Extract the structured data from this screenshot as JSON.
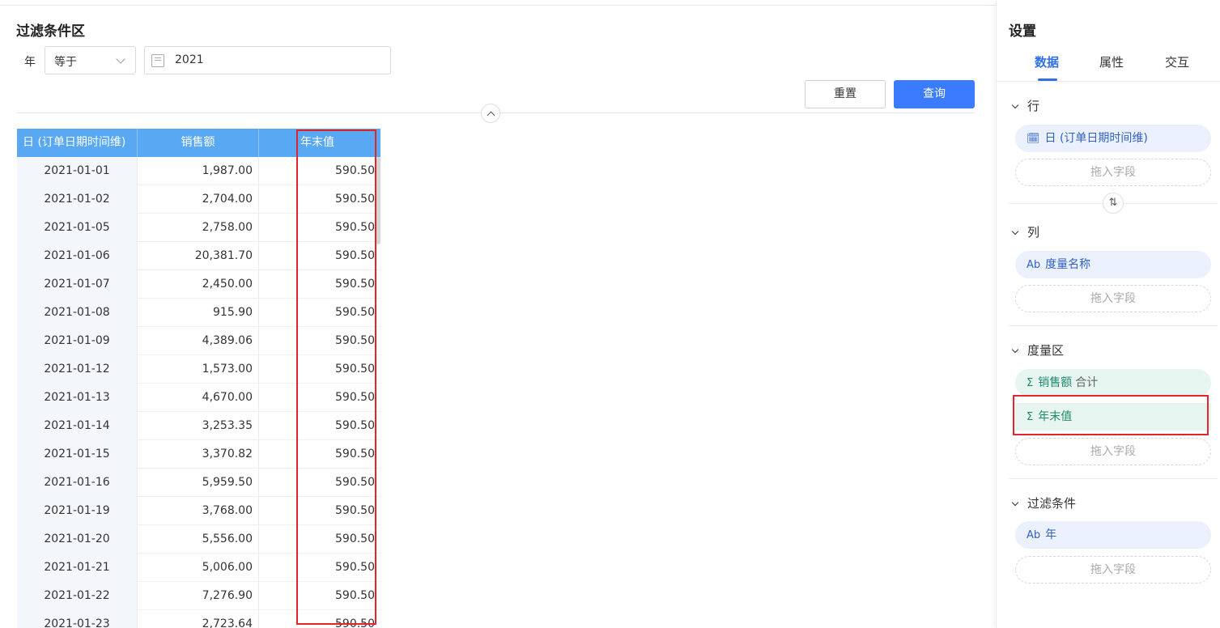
{
  "filter": {
    "title": "过滤条件区",
    "field_label": "年",
    "operator": "等于",
    "value": "2021",
    "reset_label": "重置",
    "query_label": "查询"
  },
  "table": {
    "headers": [
      "日 (订单日期时间维)",
      "销售额",
      "年末值"
    ],
    "rows": [
      [
        "2021-01-01",
        "1,987.00",
        "590.50"
      ],
      [
        "2021-01-02",
        "2,704.00",
        "590.50"
      ],
      [
        "2021-01-05",
        "2,758.00",
        "590.50"
      ],
      [
        "2021-01-06",
        "20,381.70",
        "590.50"
      ],
      [
        "2021-01-07",
        "2,450.00",
        "590.50"
      ],
      [
        "2021-01-08",
        "915.90",
        "590.50"
      ],
      [
        "2021-01-09",
        "4,389.06",
        "590.50"
      ],
      [
        "2021-01-12",
        "1,573.00",
        "590.50"
      ],
      [
        "2021-01-13",
        "4,670.00",
        "590.50"
      ],
      [
        "2021-01-14",
        "3,253.35",
        "590.50"
      ],
      [
        "2021-01-15",
        "3,370.82",
        "590.50"
      ],
      [
        "2021-01-16",
        "5,959.50",
        "590.50"
      ],
      [
        "2021-01-19",
        "3,768.00",
        "590.50"
      ],
      [
        "2021-01-20",
        "5,556.00",
        "590.50"
      ],
      [
        "2021-01-21",
        "5,006.00",
        "590.50"
      ],
      [
        "2021-01-22",
        "7,276.90",
        "590.50"
      ],
      [
        "2021-01-23",
        "2,723.64",
        "590.50"
      ]
    ]
  },
  "panel": {
    "title": "设置",
    "tabs": [
      "数据",
      "属性",
      "交互"
    ],
    "drop_placeholder": "拖入字段",
    "sections": {
      "row": {
        "title": "行",
        "field": "日 (订单日期时间维)",
        "icon": "date-icon"
      },
      "col": {
        "title": "列",
        "field": "度量名称",
        "icon": "text-field-icon",
        "icon_glyph": "Ab"
      },
      "measure": {
        "title": "度量区",
        "fields": [
          {
            "name": "销售额",
            "agg": "合计",
            "icon": "sigma-icon",
            "icon_glyph": "Σ"
          },
          {
            "name": "年末值",
            "icon": "calc-sigma-icon",
            "icon_glyph": "Σ"
          }
        ]
      },
      "filter": {
        "title": "过滤条件",
        "field": "年",
        "icon": "text-field-icon",
        "icon_glyph": "Ab"
      }
    }
  },
  "colors": {
    "accent": "#3b7cff",
    "table_header": "#59a8f3",
    "highlight": "#e0262a"
  }
}
